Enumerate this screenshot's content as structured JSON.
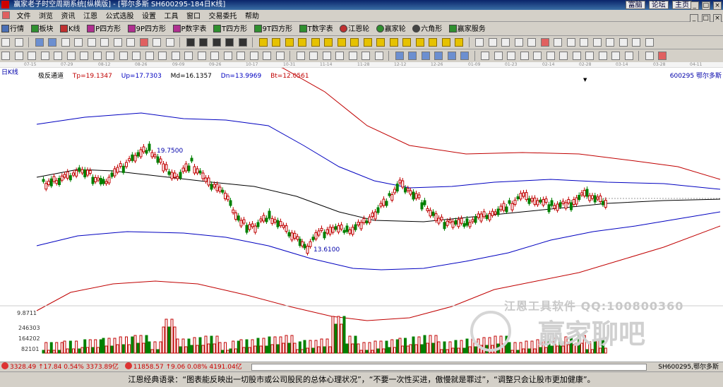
{
  "window": {
    "title": "赢家老子时空周期系统[纵横版] - [鄂尔多斯  SH600295-184日K线]",
    "links": [
      "富脑",
      "论坛",
      "主页"
    ],
    "controls": [
      "_",
      "□",
      "×"
    ]
  },
  "menu": [
    "文件",
    "浏览",
    "资讯",
    "江恩",
    "公式选股",
    "设置",
    "工具",
    "窗口",
    "交易委托",
    "帮助"
  ],
  "mdi_controls": [
    "_",
    "□",
    "×"
  ],
  "toolbar1": [
    {
      "icon": "grid-icon",
      "label": "行情",
      "color": "#4a6fb5"
    },
    {
      "icon": "blocks-icon",
      "label": "板块",
      "color": "#2f8f2f"
    },
    {
      "icon": "kline-icon",
      "label": "K线",
      "color": "#c03030"
    },
    {
      "icon": "square-p-icon",
      "label": "P四方形",
      "color": "#b03090"
    },
    {
      "icon": "square-9p-icon",
      "label": "9P四方形",
      "color": "#b03090"
    },
    {
      "icon": "square-p-icon",
      "label": "P数字表",
      "color": "#b03090"
    },
    {
      "icon": "square-t-icon",
      "label": "T四方形",
      "color": "#2f8f2f"
    },
    {
      "icon": "square-9t-icon",
      "label": "9T四方形",
      "color": "#2f8f2f"
    },
    {
      "icon": "square-t-icon",
      "label": "T数字表",
      "color": "#2f8f2f"
    },
    {
      "icon": "wheel-icon",
      "label": "江恩轮",
      "color": "#c03030"
    },
    {
      "icon": "wheel-icon",
      "label": "赢家轮",
      "color": "#2f8f2f"
    },
    {
      "icon": "hexagon-icon",
      "label": "六角形",
      "color": "#444444"
    },
    {
      "icon": "service-icon",
      "label": "赢家服务",
      "color": "#2f8f2f"
    }
  ],
  "chart": {
    "period_label": "日K线",
    "stock_code": "600295",
    "stock_name": "鄂尔多斯",
    "indicator_name": "极反通道",
    "indicators": [
      {
        "label": "Tp=19.1347",
        "color": "#c00000"
      },
      {
        "label": "Up=17.7303",
        "color": "#0000c0"
      },
      {
        "label": "Md=16.1357",
        "color": "#000000"
      },
      {
        "label": "Dn=13.9969",
        "color": "#0000c0"
      },
      {
        "label": "Bt=12.0561",
        "color": "#c00000"
      }
    ],
    "high_label": "19.7500",
    "low_label": "13.6100",
    "volume_axis": [
      "9.8711",
      "246303",
      "164202",
      "82101"
    ],
    "dates": [
      "07-15",
      "07-29",
      "08-12",
      "08-26",
      "09-09",
      "09-26",
      "10-17",
      "10-31",
      "11-14",
      "11-28",
      "12-12",
      "12-26",
      "01-09",
      "01-23",
      "02-14",
      "02-28",
      "03-14",
      "03-28",
      "04-11"
    ]
  },
  "watermark": {
    "line1": "江恩工具软件  QQ:100800360",
    "line2": "赢家聊吧"
  },
  "status": {
    "sh_index": "3328.49 ↑17.84 0.54% 3373.89亿",
    "sz_index": "11858.57 ↑9.06 0.08% 4191.04亿",
    "stock_info": "SH600295,鄂尔多斯"
  },
  "quote": "江恩经典语录：“图表能反映出一切股市或公司股民的总体心理状况”，“不要一次性买进，傲慢就是罪过”，“调整只会让股市更加健康”。"
}
